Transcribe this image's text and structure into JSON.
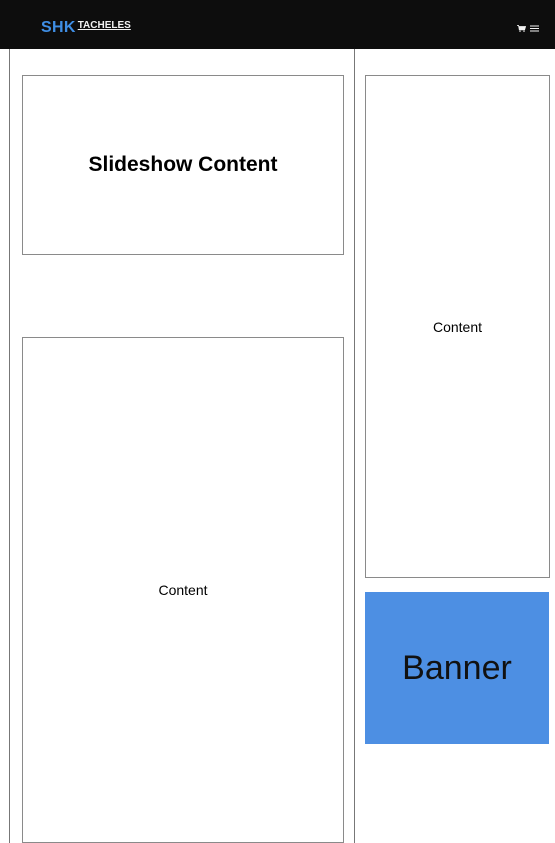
{
  "header": {
    "logo_primary": "SHK",
    "logo_secondary": "TACHELES",
    "cart_icon": "cart-icon",
    "menu_icon": "menu-icon"
  },
  "main": {
    "slideshow_label": "Slideshow Content",
    "content_label": "Content"
  },
  "sidebar": {
    "content_label": "Content",
    "banner_label": "Banner"
  },
  "colors": {
    "header_bg": "#0d0d0d",
    "logo_blue": "#3f8ee4",
    "banner_bg": "#4d8fe3"
  }
}
